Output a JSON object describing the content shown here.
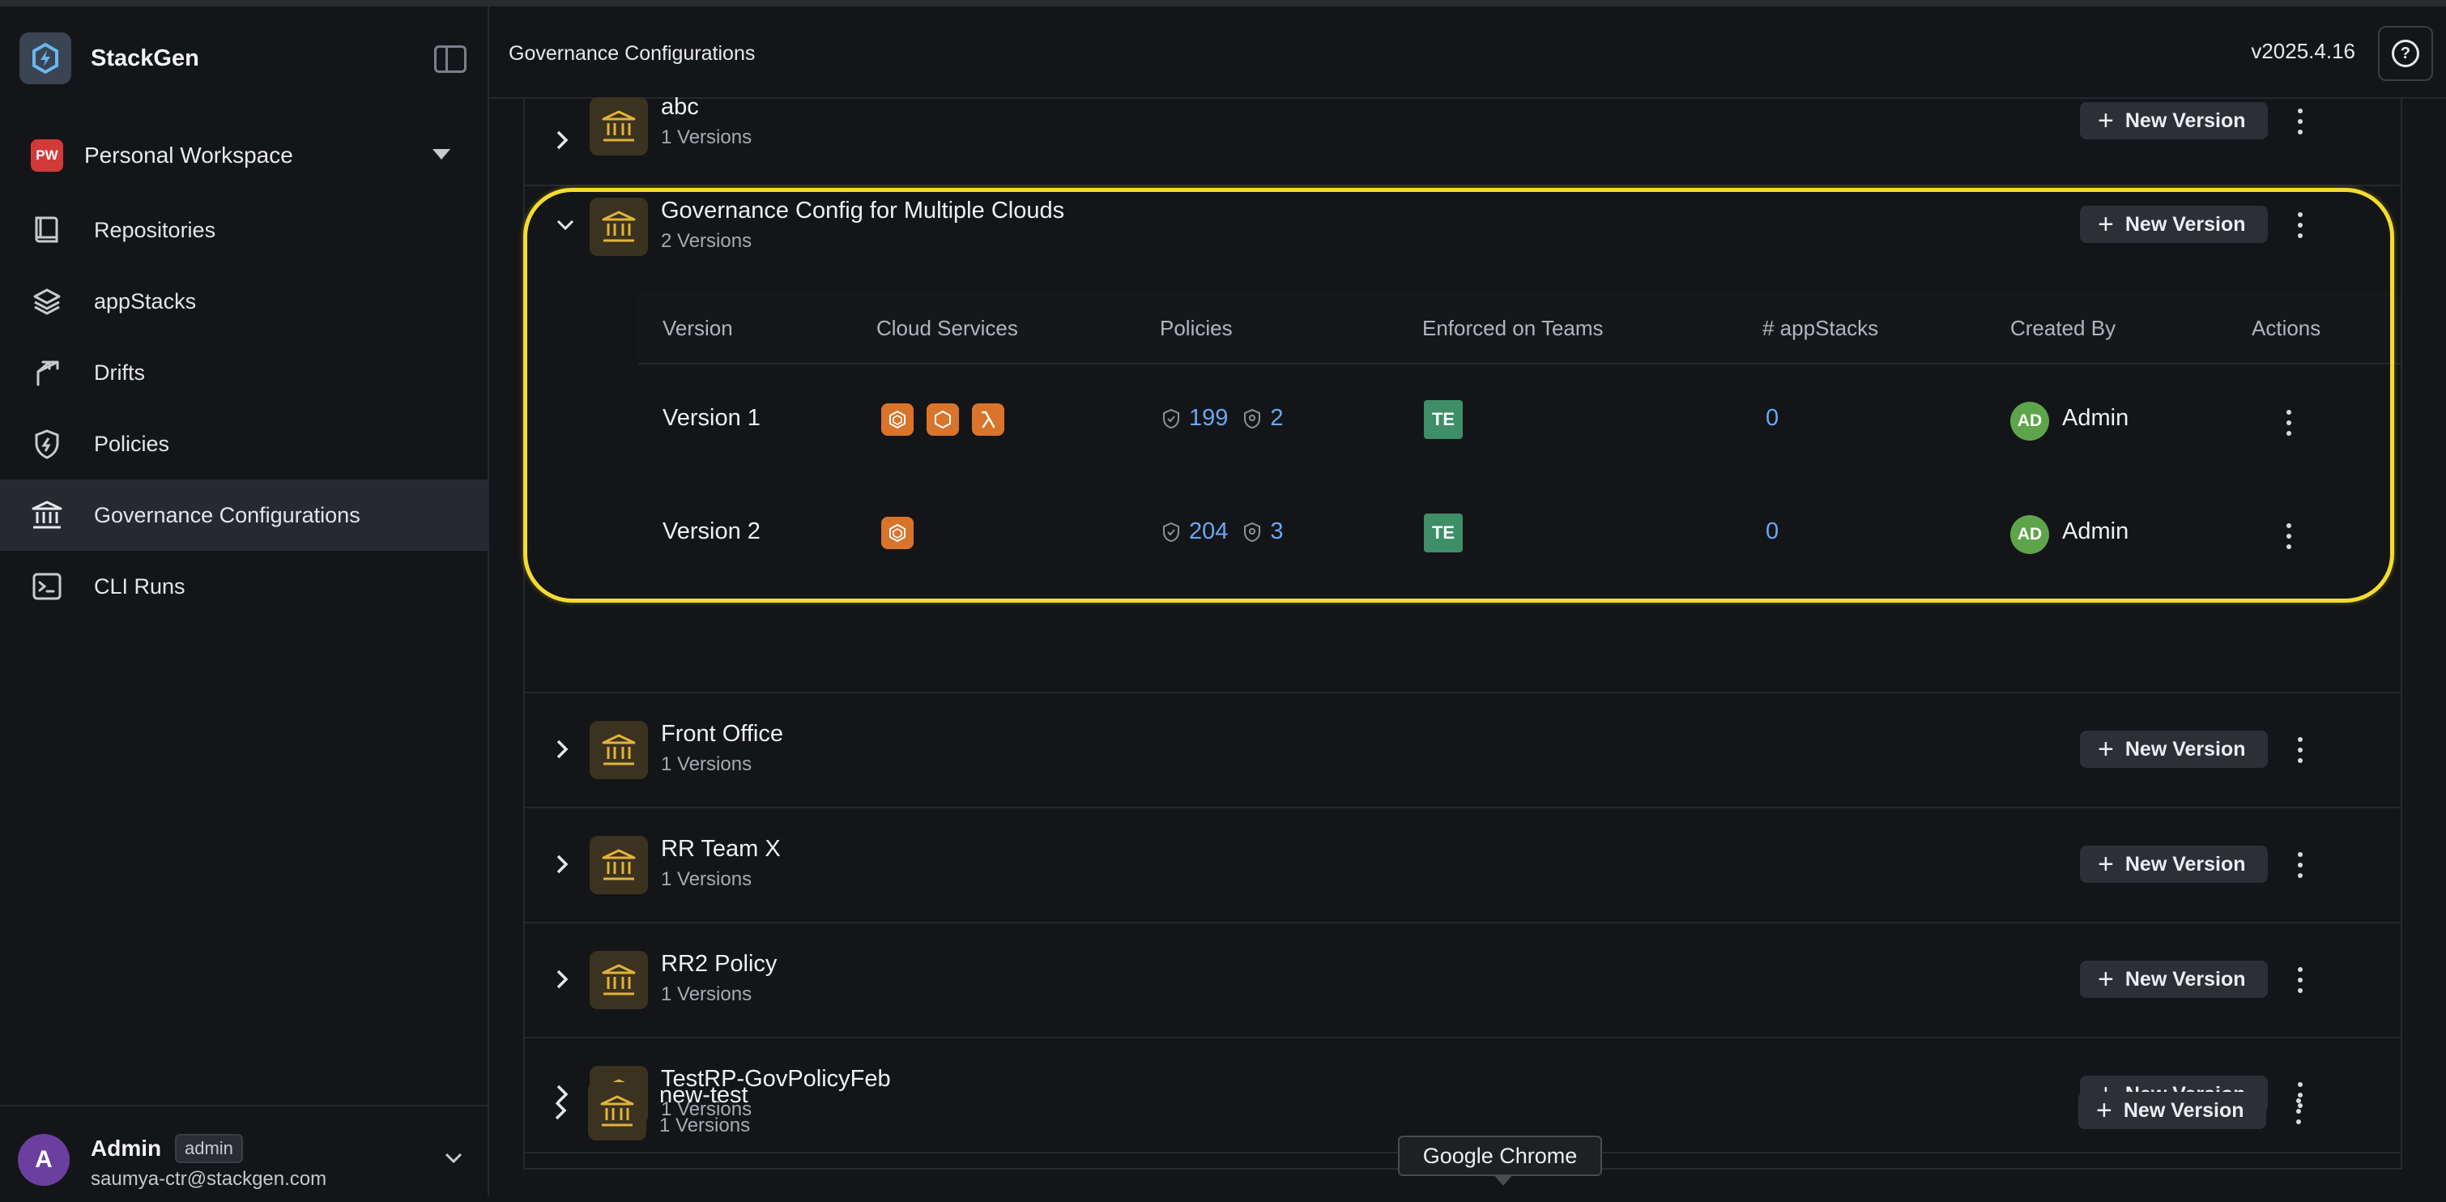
{
  "app": {
    "name": "StackGen",
    "version": "v2025.4.16"
  },
  "workspace": {
    "badge": "PW",
    "name": "Personal Workspace"
  },
  "nav": [
    {
      "label": "Repositories",
      "icon": "book-icon"
    },
    {
      "label": "appStacks",
      "icon": "layers-icon"
    },
    {
      "label": "Drifts",
      "icon": "branch-icon"
    },
    {
      "label": "Policies",
      "icon": "shield-icon"
    },
    {
      "label": "Governance Configurations",
      "icon": "bank-icon",
      "active": true
    },
    {
      "label": "CLI Runs",
      "icon": "terminal-icon"
    }
  ],
  "user": {
    "initial": "A",
    "name": "Admin",
    "role": "admin",
    "email": "saumya-ctr@stackgen.com"
  },
  "header": {
    "title": "Governance Configurations"
  },
  "new_version_label": "New Version",
  "configs": [
    {
      "name": "abc",
      "versions": "1 Versions"
    },
    {
      "name": "Governance Config for Multiple Clouds",
      "versions": "2 Versions",
      "expanded": true
    },
    {
      "name": "Front Office",
      "versions": "1 Versions"
    },
    {
      "name": "RR Team X",
      "versions": "1 Versions"
    },
    {
      "name": "RR2 Policy",
      "versions": "1 Versions"
    },
    {
      "name": "TestRP-GovPolicyFeb",
      "versions": "1 Versions"
    },
    {
      "name": "new-test",
      "versions": "1 Versions"
    }
  ],
  "version_table": {
    "columns": [
      "Version",
      "Cloud Services",
      "Policies",
      "Enforced on Teams",
      "# appStacks",
      "Created By",
      "Actions"
    ],
    "rows": [
      {
        "version": "Version 1",
        "services": [
          "aws-service-icon",
          "aws-service-icon",
          "lambda-icon"
        ],
        "policies": "199",
        "rules": "2",
        "team": "TE",
        "appstacks": "0",
        "creator_initials": "AD",
        "creator": "Admin"
      },
      {
        "version": "Version 2",
        "services": [
          "aws-service-icon"
        ],
        "policies": "204",
        "rules": "3",
        "team": "TE",
        "appstacks": "0",
        "creator_initials": "AD",
        "creator": "Admin"
      }
    ]
  },
  "tooltip": "Google Chrome"
}
